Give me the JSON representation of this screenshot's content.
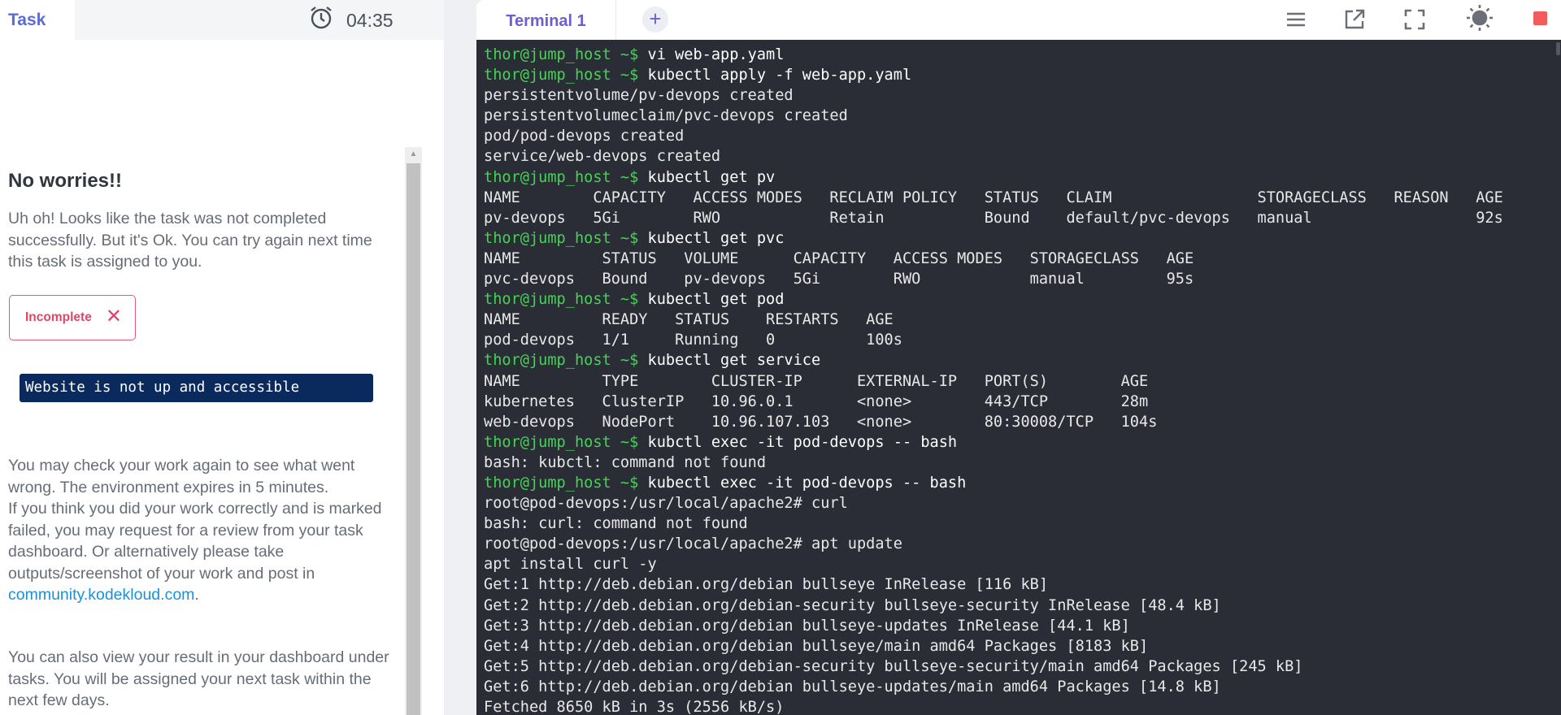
{
  "task_panel": {
    "tab_label": "Task",
    "timer": "04:35",
    "title": "No worries!!",
    "message": "Uh oh! Looks like the task was not completed successfully. But it's Ok. You can try again next time this task is assigned to you.",
    "status_badge": "Incomplete",
    "error": "Website is not up and accessible",
    "check_again": "You may check your work again to see what went wrong. The environment expires in 5 minutes.",
    "review_text": "If you think you did your work correctly and is marked failed, you may request for a review from your task dashboard. Or alternatively please take outputs/screenshot of your work and post in",
    "community_link": "community.kodekloud.com",
    "review_end": ".",
    "dashboard_text": "You can also view your result in your dashboard under tasks. You will be assigned your next task within the next few days."
  },
  "terminal": {
    "tab_label": "Terminal 1",
    "add_tab": "+",
    "icons": [
      "menu-icon",
      "open-external-icon",
      "fullscreen-icon",
      "theme-icon",
      "stop-icon"
    ],
    "colors": {
      "prompt": "#48d157",
      "background": "#2b2d36",
      "text": "#e8e8e8"
    },
    "lines": [
      {
        "prompt": "thor@jump_host ~$ ",
        "text": "vi web-app.yaml"
      },
      {
        "prompt": "thor@jump_host ~$ ",
        "text": "kubectl apply -f web-app.yaml"
      },
      {
        "prompt": "",
        "text": "persistentvolume/pv-devops created"
      },
      {
        "prompt": "",
        "text": "persistentvolumeclaim/pvc-devops created"
      },
      {
        "prompt": "",
        "text": "pod/pod-devops created"
      },
      {
        "prompt": "",
        "text": "service/web-devops created"
      },
      {
        "prompt": "thor@jump_host ~$ ",
        "text": "kubectl get pv"
      },
      {
        "prompt": "",
        "text": "NAME        CAPACITY   ACCESS MODES   RECLAIM POLICY   STATUS   CLAIM                STORAGECLASS   REASON   AGE"
      },
      {
        "prompt": "",
        "text": "pv-devops   5Gi        RWO            Retain           Bound    default/pvc-devops   manual                  92s"
      },
      {
        "prompt": "thor@jump_host ~$ ",
        "text": "kubectl get pvc"
      },
      {
        "prompt": "",
        "text": "NAME         STATUS   VOLUME      CAPACITY   ACCESS MODES   STORAGECLASS   AGE"
      },
      {
        "prompt": "",
        "text": "pvc-devops   Bound    pv-devops   5Gi        RWO            manual         95s"
      },
      {
        "prompt": "thor@jump_host ~$ ",
        "text": "kubectl get pod"
      },
      {
        "prompt": "",
        "text": "NAME         READY   STATUS    RESTARTS   AGE"
      },
      {
        "prompt": "",
        "text": "pod-devops   1/1     Running   0          100s"
      },
      {
        "prompt": "thor@jump_host ~$ ",
        "text": "kubectl get service"
      },
      {
        "prompt": "",
        "text": "NAME         TYPE        CLUSTER-IP      EXTERNAL-IP   PORT(S)        AGE"
      },
      {
        "prompt": "",
        "text": "kubernetes   ClusterIP   10.96.0.1       <none>        443/TCP        28m"
      },
      {
        "prompt": "",
        "text": "web-devops   NodePort    10.96.107.103   <none>        80:30008/TCP   104s"
      },
      {
        "prompt": "thor@jump_host ~$ ",
        "text": "kubctl exec -it pod-devops -- bash"
      },
      {
        "prompt": "",
        "text": "bash: kubctl: command not found"
      },
      {
        "prompt": "thor@jump_host ~$ ",
        "text": "kubectl exec -it pod-devops -- bash"
      },
      {
        "prompt": "",
        "text": "root@pod-devops:/usr/local/apache2# curl"
      },
      {
        "prompt": "",
        "text": "bash: curl: command not found"
      },
      {
        "prompt": "",
        "text": "root@pod-devops:/usr/local/apache2# apt update"
      },
      {
        "prompt": "",
        "text": "apt install curl -y"
      },
      {
        "prompt": "",
        "text": "Get:1 http://deb.debian.org/debian bullseye InRelease [116 kB]"
      },
      {
        "prompt": "",
        "text": "Get:2 http://deb.debian.org/debian-security bullseye-security InRelease [48.4 kB]"
      },
      {
        "prompt": "",
        "text": "Get:3 http://deb.debian.org/debian bullseye-updates InRelease [44.1 kB]"
      },
      {
        "prompt": "",
        "text": "Get:4 http://deb.debian.org/debian bullseye/main amd64 Packages [8183 kB]"
      },
      {
        "prompt": "",
        "text": "Get:5 http://deb.debian.org/debian-security bullseye-security/main amd64 Packages [245 kB]"
      },
      {
        "prompt": "",
        "text": "Get:6 http://deb.debian.org/debian bullseye-updates/main amd64 Packages [14.8 kB]"
      },
      {
        "prompt": "",
        "text": "Fetched 8650 kB in 3s (2556 kB/s)"
      }
    ]
  }
}
